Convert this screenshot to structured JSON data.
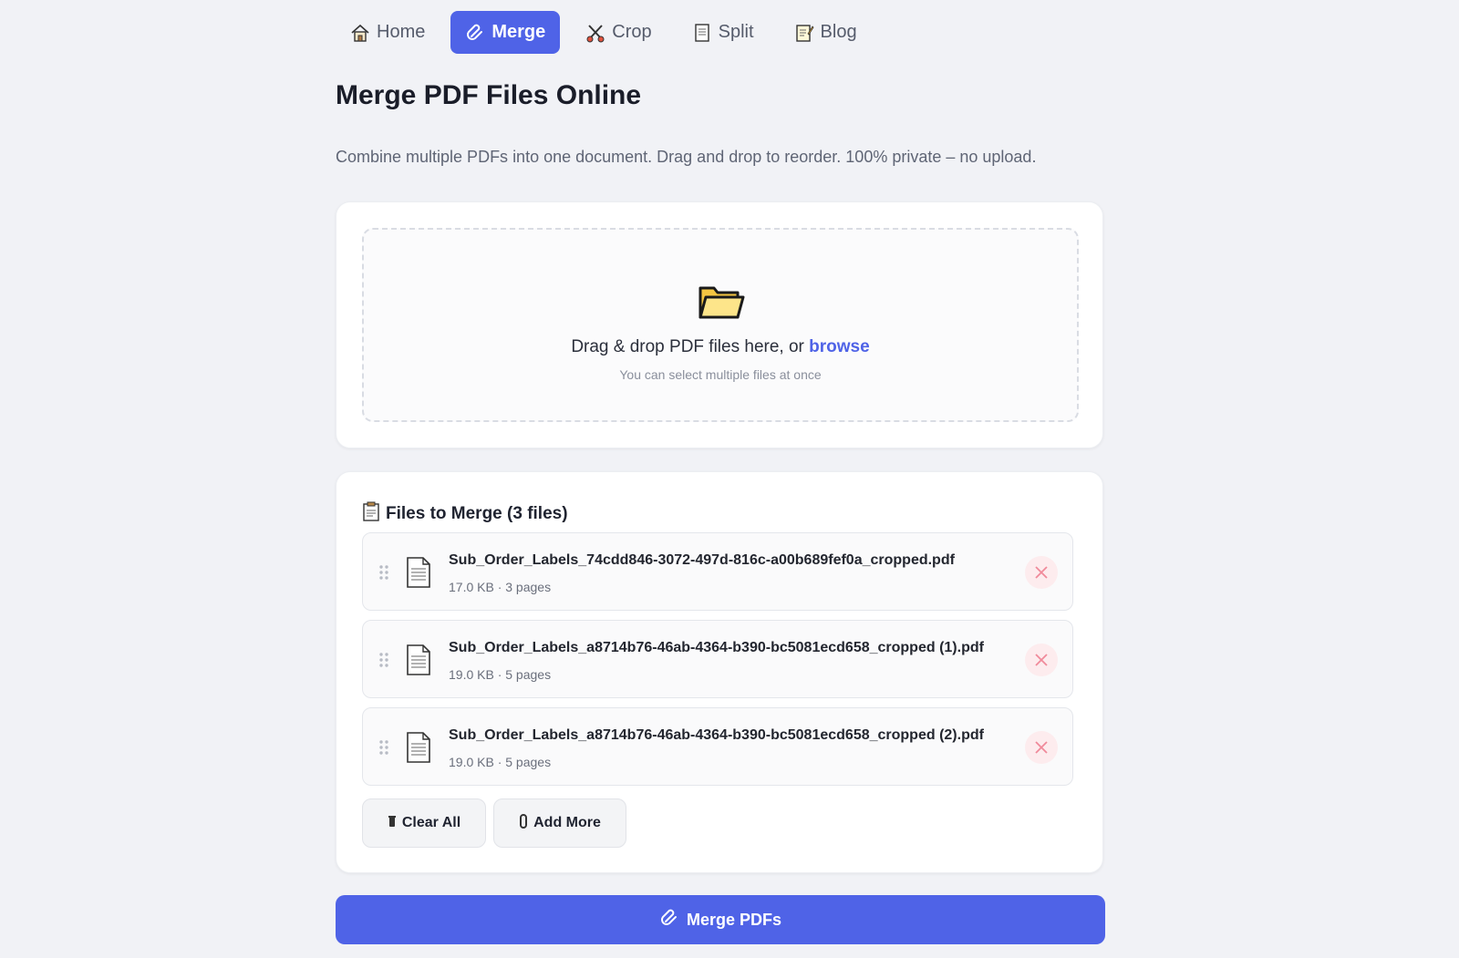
{
  "nav": {
    "items": [
      {
        "label": "Home",
        "icon": "house-icon",
        "active": false
      },
      {
        "label": "Merge",
        "icon": "paperclip-icon",
        "active": true
      },
      {
        "label": "Crop",
        "icon": "scissors-icon",
        "active": false
      },
      {
        "label": "Split",
        "icon": "page-icon",
        "active": false
      },
      {
        "label": "Blog",
        "icon": "memo-icon",
        "active": false
      }
    ]
  },
  "page": {
    "title": "Merge PDF Files Online",
    "subtitle": "Combine multiple PDFs into one document. Drag and drop to reorder. 100% private – no upload."
  },
  "dropzone": {
    "text": "Drag & drop PDF files here, or ",
    "browse_label": "browse",
    "hint": "You can select multiple files at once"
  },
  "files": {
    "heading": "Files to Merge (3 files)",
    "items": [
      {
        "name": "Sub_Order_Labels_74cdd846-3072-497d-816c-a00b689fef0a_cropped.pdf",
        "meta": "17.0 KB · 3 pages"
      },
      {
        "name": "Sub_Order_Labels_a8714b76-46ab-4364-b390-bc5081ecd658_cropped (1).pdf",
        "meta": "19.0 KB · 5 pages"
      },
      {
        "name": "Sub_Order_Labels_a8714b76-46ab-4364-b390-bc5081ecd658_cropped (2).pdf",
        "meta": "19.0 KB · 5 pages"
      }
    ],
    "clear_label": "Clear All",
    "add_label": "Add More"
  },
  "merge_button": {
    "label": "Merge PDFs"
  },
  "colors": {
    "accent": "#4f63e7",
    "remove": "#f08a9a"
  }
}
